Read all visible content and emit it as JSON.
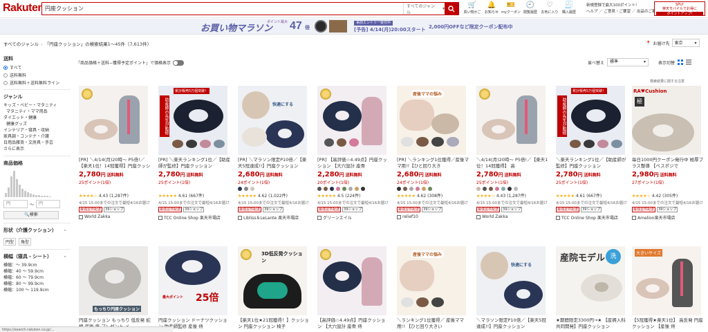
{
  "header": {
    "logo": "Rakuten",
    "search_value": "円座クッション",
    "genre_select": "すべてのジャンル",
    "icons": [
      {
        "label": "買い物かご",
        "icon": "cart-icon"
      },
      {
        "label": "お知らせ",
        "icon": "bell-icon"
      },
      {
        "label": "myクーポン",
        "icon": "coupon-icon"
      },
      {
        "label": "閲覧履歴",
        "icon": "history-icon"
      },
      {
        "label": "お気に入り",
        "icon": "heart-icon"
      },
      {
        "label": "購入履歴",
        "icon": "receipt-icon"
      }
    ],
    "link1": "新規登録で最大100ポイント!",
    "link2": "ヘルプ ／ ご意見・ご要望 ／ 出品のご案内",
    "promo1": "SPU!",
    "promo2": "楽天モバイルでお得に",
    "promo3": "ポイントアップ!"
  },
  "banner": {
    "title": "お買い物マラソン",
    "point_label": "ポイント最大",
    "times": "47",
    "times_unit": "倍",
    "entry": "事前エントリー受付中",
    "entry_date": "[予告] 4/14(月)20:00スタート",
    "coupon": "2,000円OFFなど限定クーポン配布中"
  },
  "breadcrumb": {
    "root": "すべてのジャンル",
    "query": "「円座クッション」の検索結果1〜45件（7,613件）"
  },
  "delivery": {
    "label": "お届け先",
    "value": "東京"
  },
  "sidebar": {
    "shipping_title": "送料",
    "shipping_options": [
      "すべて",
      "送料無料",
      "送料無料＋送料無料ライン"
    ],
    "genre_title": "ジャンル",
    "genres": [
      "キッズ・ベビー・マタニティ",
      "マタニティ・ママ用品",
      "ダイエット・健康",
      "健康グッズ",
      "インテリア・寝具・収納",
      "家具調・コンテナ・介護",
      "日用品雑貨・文房具・手芸",
      "さらに表示"
    ],
    "price_title": "商品価格",
    "price_from_placeholder": "円",
    "price_to_placeholder": "円",
    "price_sep": "〜",
    "price_search": "検索",
    "shape_title": "形状（介護クッション）",
    "shapes": [
      "円型",
      "角型"
    ],
    "size_title": "横幅（寝具・シート）",
    "sizes": [
      "横幅：〜 39.9cm",
      "横幅：40 〜 59.9cm",
      "横幅：60 〜 79.9cm",
      "横幅：80 〜 99.9cm",
      "横幅：100 〜 119.9cm"
    ]
  },
  "toolbar": {
    "toggle_label": "「商品価格＋送料−獲得予定ポイント」で価格表示",
    "sort_label": "並べ替え",
    "sort_value": "標準",
    "view_label": "表示切替",
    "ad_note": "検索結果に関する注意"
  },
  "products": [
    {
      "name": "[PR] ＼4/14(月)20時〜 P5倍!／【楽天1位！14冠獲得】円座クッション",
      "price": "2,780",
      "yen": "円",
      "ship": "送料無料",
      "points": "25ポイント(1倍)",
      "rating": "4.43",
      "reviews": "(1,287件)",
      "note": "4/15 15:00までの注文で最短4/16お届け",
      "tags": [
        "最強翌日配送",
        "39ショップ"
      ],
      "shop": "World Zakka"
    },
    {
      "name": "[PR] ＼楽天ランキング1位／【助産師が監修】円座クッション",
      "price": "2,780",
      "yen": "円",
      "ship": "送料無料",
      "points": "25ポイント(1倍)",
      "rating": "4.61",
      "reviews": "(667件)",
      "note": "4/15 15:00までの注文で最短4/16お届け",
      "tags": [
        "最強翌日配送",
        "39ショップ"
      ],
      "shop": "TCC Online Shop 楽天市場店"
    },
    {
      "name": "[PR] ＼マラソン限定P10倍／【楽天5冠達成!!】円座クッション",
      "price": "2,680",
      "yen": "円",
      "ship": "送料無料",
      "points": "24ポイント(1倍)",
      "rating": "4.62",
      "reviews": "(1,022件)",
      "note": "4/15 15:00までの注文で最短4/16お届け",
      "tags": [
        "最強翌日配送",
        "39ショップ"
      ],
      "shop": "Libliss＆LeLante 楽天市場店"
    },
    {
      "name": "[PR] 【高評価☆4.49点】円座クッション 【大穴設計 座骨",
      "price": "2,280",
      "yen": "円",
      "ship": "送料無料",
      "points": "20ポイント(1倍)",
      "rating": "4.5",
      "reviews": "(224件)",
      "note": "4/15 15:00までの注文で最短4/16お届け",
      "tags": [
        "最強翌日配送",
        "39ショップ"
      ],
      "shop": "グリーンエイル"
    },
    {
      "name": "[PR] ＼ランキング1位獲得／産後ママ用!!【ひと回り大き",
      "price": "2,680",
      "yen": "円",
      "ship": "送料無料",
      "points": "24ポイント(1倍)",
      "rating": "4.62",
      "reviews": "(308件)",
      "note": "4/15 15:00までの注文で最短4/16お届け",
      "tags": [
        "最強翌日配送",
        "39ショップ"
      ],
      "shop": "relief10"
    },
    {
      "name": "＼4/14(月)20時〜 P5倍!／【楽天1位！14冠獲得】 高",
      "price": "2,780",
      "yen": "円",
      "ship": "送料無料",
      "points": "25ポイント(1倍)",
      "rating": "4.43",
      "reviews": "(1,287件)",
      "note": "4/15 15:00までの注文で最短4/16お届け",
      "tags": [
        "最強翌日配送",
        "39ショップ"
      ],
      "shop": "World Zakka"
    },
    {
      "name": "＼楽天ランキング1位／【助産師が監修】円座クッション",
      "price": "2,780",
      "yen": "円",
      "ship": "送料無料",
      "points": "25ポイント(1倍)",
      "rating": "4.61",
      "reviews": "(667件)",
      "note": "4/15 15:00までの注文で最短4/16お届け",
      "tags": [
        "最強翌日配送",
        "39ショップ"
      ],
      "shop": "TCC Online Shop 楽天市場店"
    },
    {
      "name": "毎日1000円クーポン発行中 極厚プラス整導 【ベスポジで",
      "price": "2,980",
      "yen": "円",
      "ship": "送料無料",
      "points": "27ポイント(1倍)",
      "rating": "4.42",
      "reviews": "(305件)",
      "note": "4/15 15:00までの注文で最短4/16お届け",
      "tags": [
        "最強翌日配送",
        "39ショップ"
      ],
      "shop": "Amelion楽天市場店"
    },
    {
      "name": "円座クッション もっちり 低反発 蛇柄 産後 痔 プレゼント メ",
      "price": "",
      "yen": "",
      "ship": "",
      "points": "",
      "rating": "",
      "reviews": "",
      "note": "",
      "tags": [],
      "shop": ""
    },
    {
      "name": "円座クッション ドーナツクッション 助産師監修 産後 痔",
      "price": "",
      "yen": "",
      "ship": "",
      "points": "",
      "rating": "",
      "reviews": "",
      "note": "",
      "tags": [],
      "shop": ""
    },
    {
      "name": "【楽天1位★21冠獲得！】クッション 円座クッション 椅子",
      "price": "",
      "yen": "",
      "ship": "",
      "points": "",
      "rating": "",
      "reviews": "",
      "note": "",
      "tags": [],
      "shop": ""
    },
    {
      "name": "【高評価☆4.49点】円座クッション 【大穴設計 座骨 痔",
      "price": "",
      "yen": "",
      "ship": "",
      "points": "",
      "rating": "",
      "reviews": "",
      "note": "",
      "tags": [],
      "shop": ""
    },
    {
      "name": "＼ランキング1位獲得／ 産後ママ用!! 【ひと回り大きい",
      "price": "",
      "yen": "",
      "ship": "",
      "points": "",
      "rating": "",
      "reviews": "",
      "note": "",
      "tags": [],
      "shop": ""
    },
    {
      "name": "＼マラソン限定P10倍／【楽天5冠達成!!】円座クッション",
      "price": "",
      "yen": "",
      "ship": "",
      "points": "",
      "rating": "",
      "reviews": "",
      "note": "",
      "tags": [],
      "shop": ""
    },
    {
      "name": "★期間限定3300円→★ 【産褥入科共同開発】円座クッション",
      "price": "",
      "yen": "",
      "ship": "",
      "points": "",
      "rating": "",
      "reviews": "",
      "note": "",
      "tags": [],
      "shop": ""
    },
    {
      "name": "【5冠獲得★楽天1位】 高反発 円座クッション 【産後 痔",
      "price": "",
      "yen": "",
      "ship": "",
      "points": "",
      "rating": "",
      "reviews": "",
      "note": "",
      "tags": [],
      "shop": ""
    }
  ],
  "image_text": {
    "p2_badge": "助産師の先生が監修",
    "p2_top": "累計販売5万個突破！",
    "p3_text": "快適にする",
    "p5_text": "産後ママの悩み",
    "p8_brand": "RA♥Cushion",
    "p9_text": "もっちり円座クッション",
    "p10_big": "25倍",
    "p10_text": "最大ポイント",
    "p11_text": "3D低反発クッション",
    "p15_text": "産院モデル",
    "p16_text": "大きいサイズ"
  },
  "status_url": "https://search.rakuten.co.jp/..."
}
